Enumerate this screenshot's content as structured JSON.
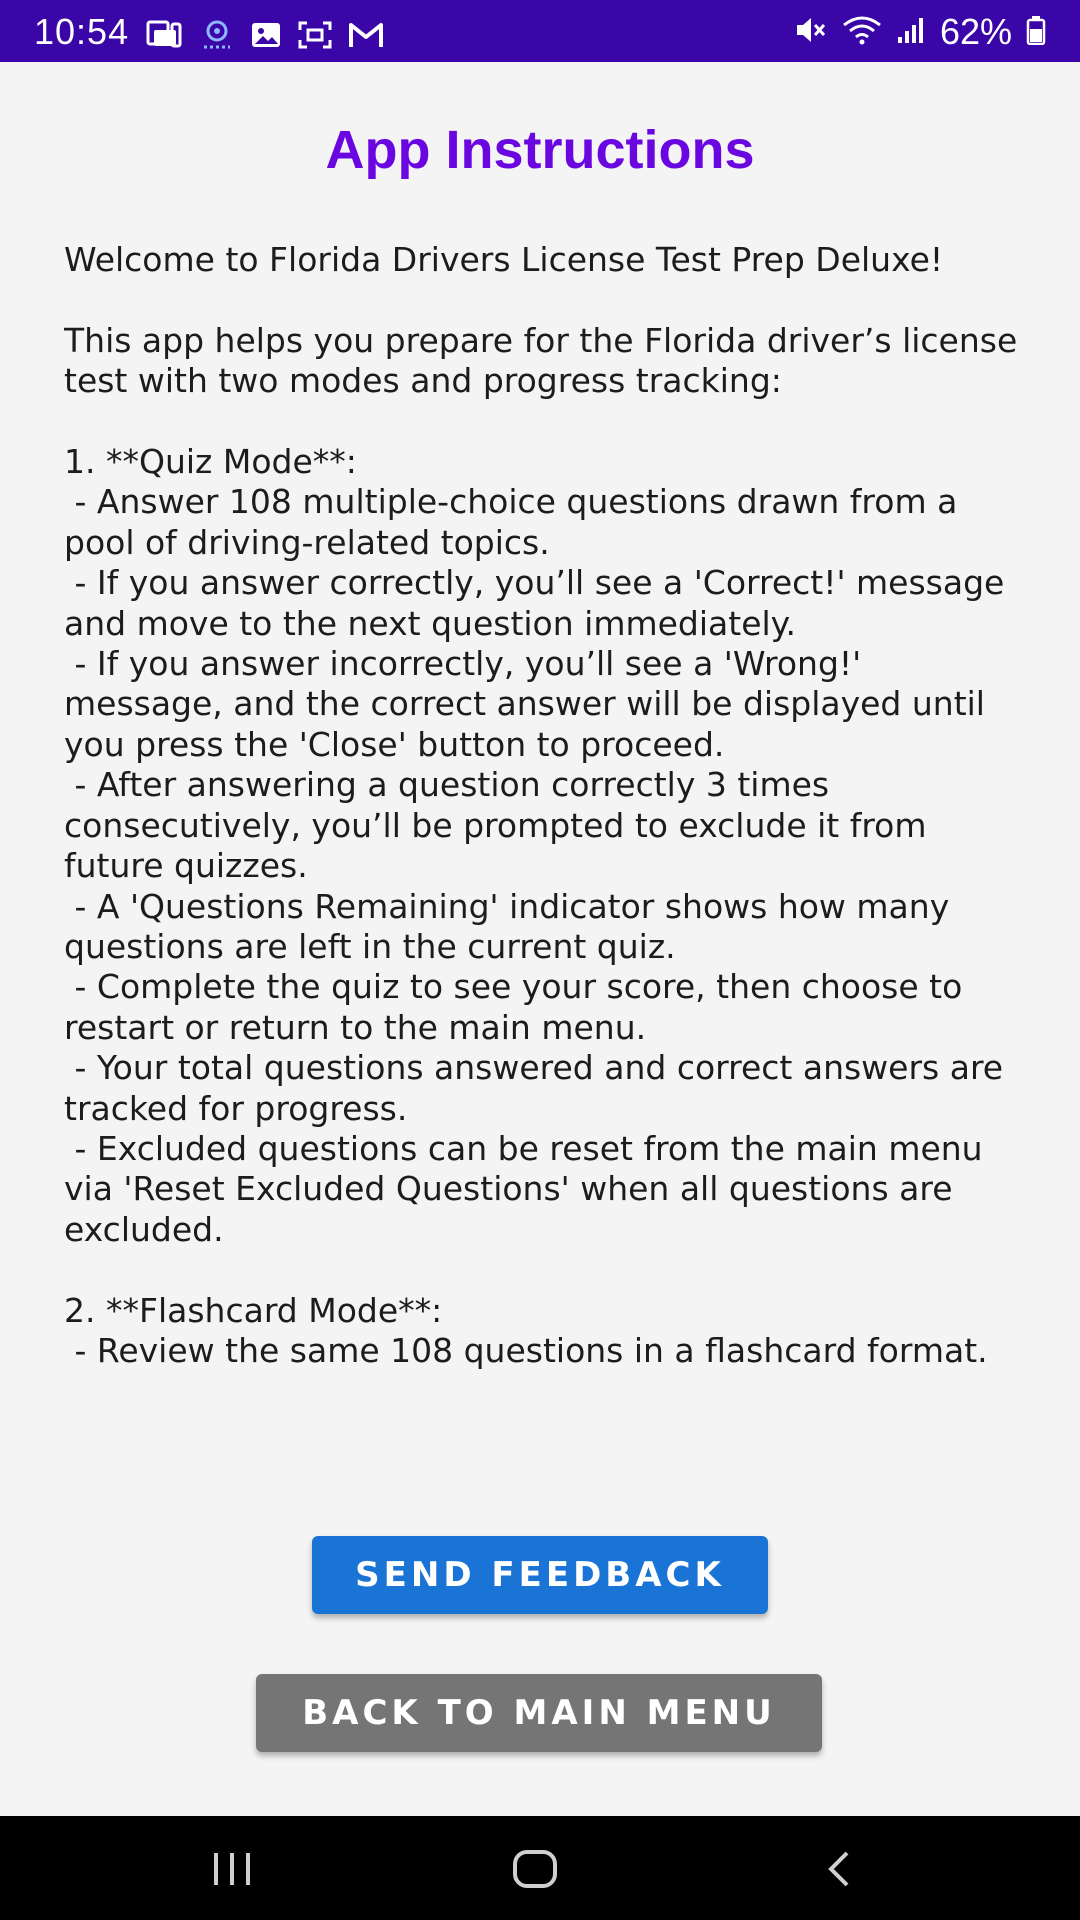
{
  "status_bar": {
    "time": "10:54",
    "battery": "62%",
    "left_icons": [
      "device-icon",
      "webcam-icon",
      "image-icon",
      "screenshot-icon",
      "gmail-icon"
    ],
    "right_icons": [
      "mute-icon",
      "wifi-icon",
      "signal-icon",
      "battery-icon"
    ],
    "background": "#3a06a8"
  },
  "page": {
    "title": "App Instructions",
    "title_color": "#6a06e0",
    "instructions": "Welcome to Florida Drivers License Test Prep Deluxe!\n\nThis app helps you prepare for the Florida driver’s license test with two modes and progress tracking:\n\n1. **Quiz Mode**:\n - Answer 108 multiple-choice questions drawn from a pool of driving-related topics.\n - If you answer correctly, you’ll see a 'Correct!' message and move to the next question immediately.\n - If you answer incorrectly, you’ll see a 'Wrong!' message, and the correct answer will be displayed until you press the 'Close' button to proceed.\n - After answering a question correctly 3 times consecutively, you’ll be prompted to exclude it from future quizzes.\n - A 'Questions Remaining' indicator shows how many questions are left in the current quiz.\n - Complete the quiz to see your score, then choose to restart or return to the main menu.\n - Your total questions answered and correct answers are tracked for progress.\n - Excluded questions can be reset from the main menu via 'Reset Excluded Questions' when all questions are excluded.\n\n2. **Flashcard Mode**:\n - Review the same 108 questions in a flashcard format."
  },
  "buttons": {
    "send_feedback": "SEND FEEDBACK",
    "back_to_main_menu": "BACK TO MAIN MENU",
    "feedback_color": "#1a74d5",
    "back_color": "#757575"
  },
  "nav_bar": {
    "recents": "recents-icon",
    "home": "home-icon",
    "back": "back-icon"
  }
}
